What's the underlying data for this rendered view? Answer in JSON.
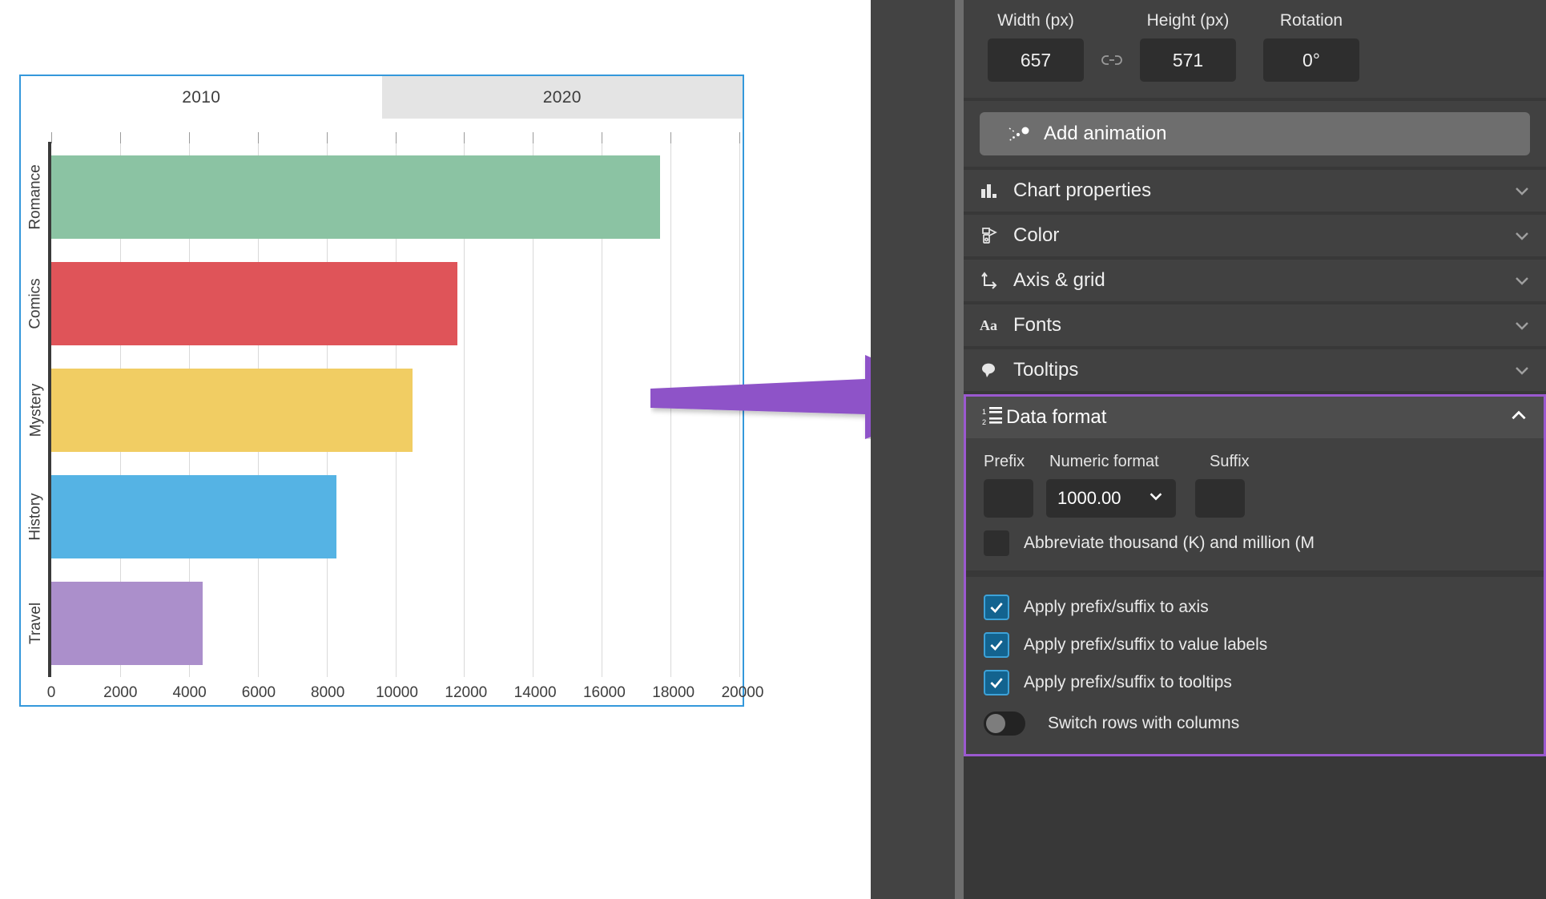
{
  "chart_data": {
    "type": "bar",
    "orientation": "horizontal",
    "title": "",
    "xlabel": "",
    "ylabel": "",
    "categories": [
      "Romance",
      "Comics",
      "Mystery",
      "History",
      "Travel"
    ],
    "values": [
      17700,
      11800,
      10500,
      8300,
      4400
    ],
    "colors": [
      "#8bc3a3",
      "#df5459",
      "#f1cd63",
      "#55b3e4",
      "#ab8fcb"
    ],
    "xticks": [
      "0",
      "2000",
      "4000",
      "6000",
      "8000",
      "10000",
      "12000",
      "14000",
      "16000",
      "18000",
      "20000"
    ],
    "xtick_values": [
      0,
      2000,
      4000,
      6000,
      8000,
      10000,
      12000,
      14000,
      16000,
      18000,
      20000
    ],
    "xlim": [
      0,
      20000
    ],
    "grid": true,
    "legend": "none",
    "series": [
      {
        "name": "2010",
        "values": [
          17700,
          11800,
          10500,
          8300,
          4400
        ]
      }
    ]
  },
  "chart_card": {
    "tabs": [
      {
        "label": "2010",
        "active": true
      },
      {
        "label": "2020",
        "active": false
      }
    ],
    "selection_color": "#3498db"
  },
  "arrow": {
    "name": "pointer-arrow",
    "color": "#8e53c8"
  },
  "panel": {
    "dimensions": {
      "width_label": "Width (px)",
      "height_label": "Height (px)",
      "rotation_label": "Rotation",
      "width_value": "657",
      "height_value": "571",
      "rotation_value": "0°",
      "link_icon": "link-icon"
    },
    "add_animation": {
      "label": "Add animation",
      "icon": "animation-sparkle-icon"
    },
    "sections": [
      {
        "label": "Chart properties",
        "icon": "bar-chart-icon",
        "expanded": false,
        "chevron": "chevron-down-icon"
      },
      {
        "label": "Color",
        "icon": "color-swatch-icon",
        "expanded": false,
        "chevron": "chevron-down-icon"
      },
      {
        "label": "Axis & grid",
        "icon": "axis-grid-icon",
        "expanded": false,
        "chevron": "chevron-down-icon"
      },
      {
        "label": "Fonts",
        "icon": "fonts-aa-icon",
        "expanded": false,
        "chevron": "chevron-down-icon"
      },
      {
        "label": "Tooltips",
        "icon": "tooltip-bubble-icon",
        "expanded": false,
        "chevron": "chevron-down-icon"
      }
    ],
    "data_format": {
      "title": "Data format",
      "icon": "numbered-list-icon",
      "chevron": "chevron-up-icon",
      "expanded": true,
      "highlight_color": "#9b59d0",
      "prefix_label": "Prefix",
      "numeric_format_label": "Numeric format",
      "suffix_label": "Suffix",
      "prefix_value": "",
      "numeric_format_value": "1000.00",
      "suffix_value": "",
      "abbreviate_label": "Abbreviate thousand (K) and million (M",
      "abbreviate_checked": false,
      "options": [
        {
          "label": "Apply prefix/suffix to axis",
          "checked": true,
          "control": "checkbox"
        },
        {
          "label": "Apply prefix/suffix to value labels",
          "checked": true,
          "control": "checkbox"
        },
        {
          "label": "Apply prefix/suffix to tooltips",
          "checked": true,
          "control": "checkbox"
        },
        {
          "label": "Switch rows with columns",
          "checked": false,
          "control": "toggle"
        }
      ]
    }
  }
}
